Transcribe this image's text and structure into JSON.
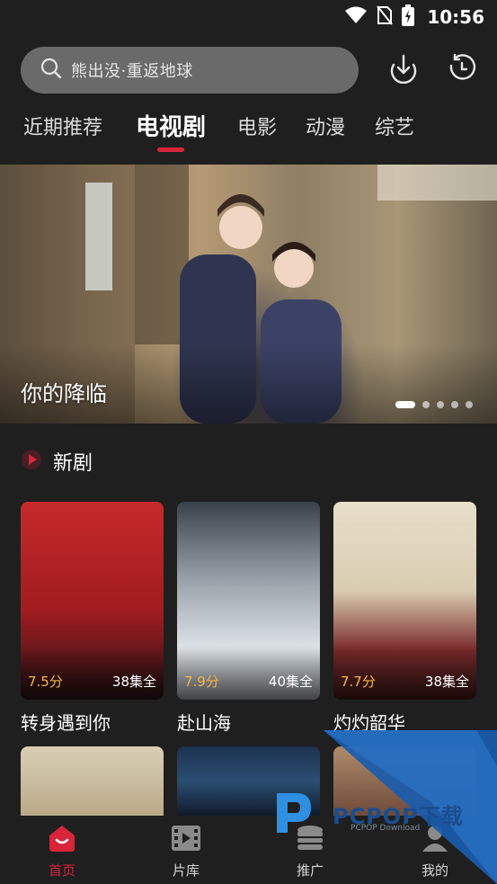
{
  "status_bar": {
    "time": "10:56"
  },
  "search": {
    "placeholder": "熊出没·重返地球"
  },
  "tabs": [
    {
      "label": "近期推荐"
    },
    {
      "label": "电视剧"
    },
    {
      "label": "电影"
    },
    {
      "label": "动漫"
    },
    {
      "label": "综艺"
    }
  ],
  "active_tab_index": 1,
  "banner": {
    "title": "你的降临",
    "dot_count": 5,
    "active_dot": 0
  },
  "section": {
    "title": "新剧"
  },
  "shows": [
    {
      "title": "转身遇到你",
      "rating": "7.5分",
      "episodes": "38集全"
    },
    {
      "title": "赴山海",
      "rating": "7.9分",
      "episodes": "40集全"
    },
    {
      "title": "灼灼韶华",
      "rating": "7.7分",
      "episodes": "38集全"
    }
  ],
  "bottom_nav": [
    {
      "label": "首页",
      "icon": "home-icon"
    },
    {
      "label": "片库",
      "icon": "film-library-icon"
    },
    {
      "label": "推广",
      "icon": "coins-icon"
    },
    {
      "label": "我的",
      "icon": "profile-icon"
    }
  ],
  "watermark": {
    "text": "PCPOP下载",
    "sub": "PCPOP Download"
  },
  "colors": {
    "accent": "#d8253a",
    "rating": "#f4b63f",
    "background": "#1f1f1f"
  }
}
